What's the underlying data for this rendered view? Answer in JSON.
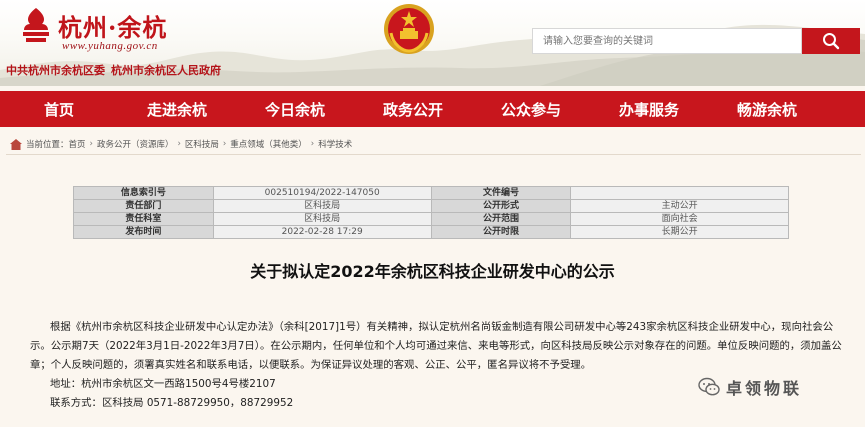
{
  "header": {
    "logo_text": "杭州·余杭",
    "logo_url": "www.yuhang.gov.cn",
    "subtitle_party": "中共杭州市余杭区委",
    "subtitle_gov": "杭州市余杭区人民政府",
    "search_placeholder": "请输入您要查询的关键词"
  },
  "nav": [
    "首页",
    "走进余杭",
    "今日余杭",
    "政务公开",
    "公众参与",
    "办事服务",
    "畅游余杭"
  ],
  "breadcrumb": {
    "prefix": "当前位置：",
    "items": [
      "首页",
      "政务公开（资源库）",
      "区科技局",
      "重点领域（其他类）",
      "科学技术"
    ]
  },
  "info_table": {
    "rows": [
      {
        "l1": "信息索引号",
        "v1": "002510194/2022-147050",
        "l2": "文件编号",
        "v2": ""
      },
      {
        "l1": "责任部门",
        "v1": "区科技局",
        "l2": "公开形式",
        "v2": "主动公开"
      },
      {
        "l1": "责任科室",
        "v1": "区科技局",
        "l2": "公开范围",
        "v2": "面向社会"
      },
      {
        "l1": "发布时间",
        "v1": "2022-02-28 17:29",
        "l2": "公开时限",
        "v2": "长期公开"
      }
    ]
  },
  "article": {
    "title": "关于拟认定2022年余杭区科技企业研发中心的公示",
    "para_lines": [
      "根据《杭州市余杭区科技企业研发中心认定办法》（余科[2017]1号）有关精神，拟认定杭州名尚钣金制造有限公司研发中心等243家余杭区科技企业研发中心，现向社会公",
      "示。公示期7天（2022年3月1日-2022年3月7日）。在公示期内，任何单位和个人均可通过来信、来电等形式，向区科技局反映公示对象存在的问题。单位反映问题的，须加盖公",
      "章；个人反映问题的，须署真实姓名和联系电话，以便联系。为保证异议处理的客观、公正、公平，匿名异议将不予受理。"
    ],
    "address": "地址：杭州市余杭区文一西路1500号4号楼2107",
    "contact": "联系方式：区科技局 0571-88729950，88729952"
  },
  "watermark": "卓领物联",
  "colors": {
    "brand_red": "#c8161d",
    "background": "#fbf6ef"
  }
}
